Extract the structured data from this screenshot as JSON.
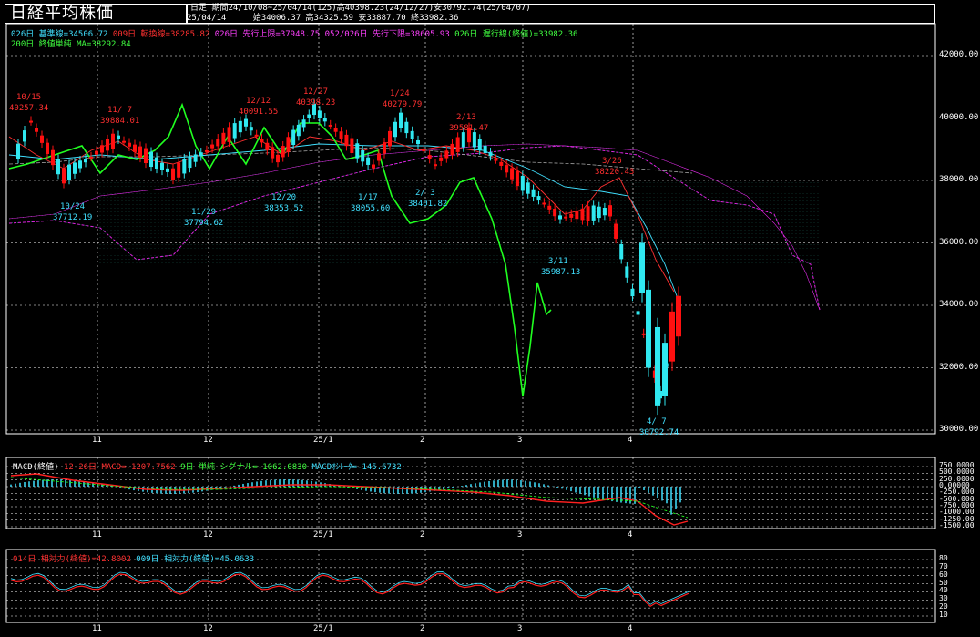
{
  "header": {
    "title": "日経平均株価",
    "period_type": "日足",
    "period_info": "期間24/10/08~25/04/14(125)高40398.23(24/12/27)安30792.74(25/04/07)",
    "date": "25/04/14",
    "ohlc": "始34006.37 高34325.59 安33887.70 終33982.36"
  },
  "legend": {
    "kijun": "026日 基準線=34506.72",
    "tenkan": "009日 転換線=38285.82",
    "senkou_a": "026日 先行上限=37948.75",
    "senkou_b": "052/026日 先行下限=38605.93",
    "chikou": "026日 遅行線(終値)=33982.36",
    "ma": "200日 終値単純 MA=38292.84"
  },
  "price_axis": {
    "ticks": [
      "42000.00",
      "40000.00",
      "38000.00",
      "36000.00",
      "34000.00",
      "32000.00",
      "30000.00"
    ]
  },
  "date_axis": {
    "labels": [
      "11",
      "12",
      "25/1",
      "2",
      "3",
      "4"
    ]
  },
  "annotations": [
    {
      "date": "10/15",
      "value": "40257.34",
      "color": "#ff3030"
    },
    {
      "date": "11/ 7",
      "value": "39884.01",
      "color": "#ff3030"
    },
    {
      "date": "12/12",
      "value": "40091.55",
      "color": "#ff3030"
    },
    {
      "date": "12/27",
      "value": "40398.23",
      "color": "#ff3030"
    },
    {
      "date": "1/24",
      "value": "40279.79",
      "color": "#ff3030"
    },
    {
      "date": "2/13",
      "value": "39581.47",
      "color": "#ff3030"
    },
    {
      "date": "3/26",
      "value": "38220.43",
      "color": "#ff3030"
    },
    {
      "date": "10/24",
      "value": "37712.19",
      "color": "#40e0ff"
    },
    {
      "date": "11/29",
      "value": "37794.62",
      "color": "#40e0ff"
    },
    {
      "date": "12/20",
      "value": "38353.52",
      "color": "#40e0ff"
    },
    {
      "date": "1/17",
      "value": "38055.60",
      "color": "#40e0ff"
    },
    {
      "date": "2/ 3",
      "value": "38401.82",
      "color": "#40e0ff"
    },
    {
      "date": "3/11",
      "value": "35987.13",
      "color": "#40e0ff"
    },
    {
      "date": "4/ 7",
      "value": "30792.74",
      "color": "#40e0ff"
    }
  ],
  "macd": {
    "label_main": "MACD(終値)",
    "label_macd": "12-26日 MACD=-1207.7562",
    "label_signal": "9日 単純 シグナル=-1062.0830",
    "label_osc": "MACDｵｼﾚｰﾀ=-145.6732",
    "ticks": [
      "750.0000",
      "500.0000",
      "250.0000",
      "0.00000",
      "-250.000",
      "-500.000",
      "-750.000",
      "-1000.00",
      "-1250.00",
      "-1500.00"
    ]
  },
  "rsi": {
    "label_14": "014日 相対力(終値)=42.8002",
    "label_9": "009日 相対力(終値)=45.0633",
    "ticks": [
      "80",
      "70",
      "60",
      "50",
      "40",
      "30",
      "20",
      "10"
    ]
  },
  "colors": {
    "up": "#ff1010",
    "down": "#30e8f0",
    "green": "#20ff20",
    "cloud": "#40e0c0",
    "span_b": "#e020e0",
    "grid": "#ffffff"
  },
  "chart_data": {
    "type": "candlestick",
    "x": [
      "10/08",
      "10/15",
      "10/24",
      "11/07",
      "11/29",
      "12/12",
      "12/20",
      "12/27",
      "1/17",
      "1/24",
      "2/03",
      "2/13",
      "3/11",
      "3/26",
      "4/07",
      "4/14"
    ],
    "close": [
      38937,
      39910,
      38143,
      39381,
      38208,
      39849,
      38701,
      40281,
      38451,
      39931,
      38520,
      39461,
      36819,
      37027,
      31136,
      33982
    ],
    "high": [
      39300,
      40257,
      38900,
      39884,
      38500,
      40091,
      39200,
      40398,
      38700,
      40280,
      38900,
      39581,
      37100,
      38220,
      31800,
      34325
    ],
    "low": [
      38600,
      39500,
      37712,
      38900,
      37794,
      39300,
      38353,
      39800,
      38055,
      39400,
      38401,
      38900,
      35987,
      36700,
      30792,
      33887
    ],
    "ylim": [
      30000,
      42500
    ]
  }
}
